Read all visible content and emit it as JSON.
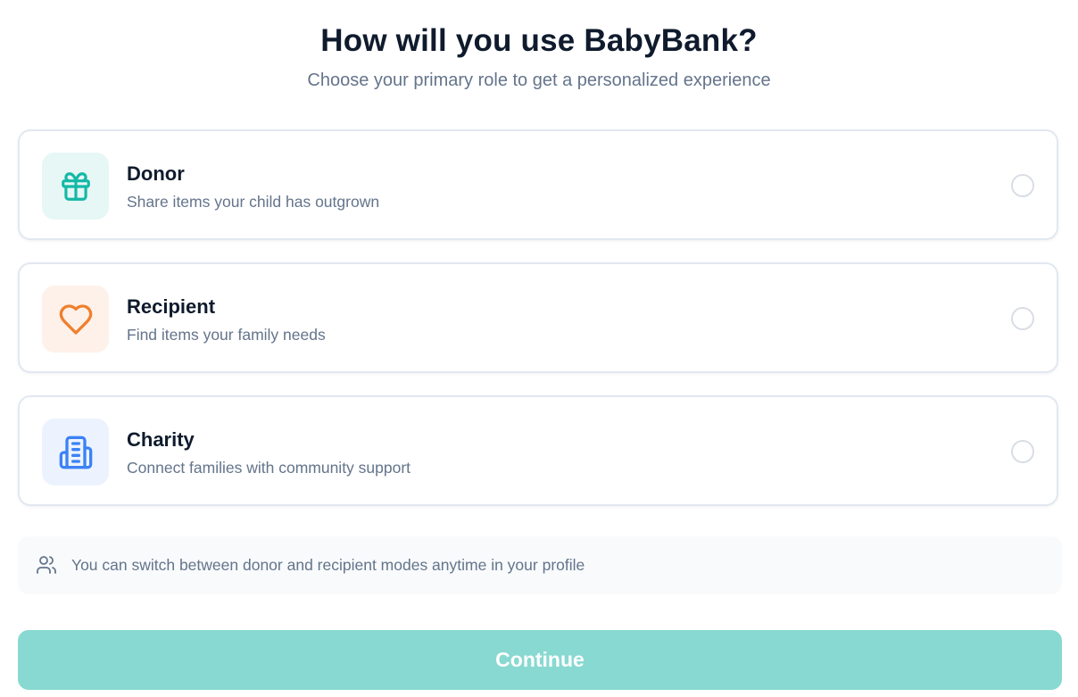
{
  "header": {
    "title": "How will you use BabyBank?",
    "subtitle": "Choose your primary role to get a personalized experience"
  },
  "roles": [
    {
      "title": "Donor",
      "description": "Share items your child has outgrown",
      "icon": "gift-icon",
      "icon_color": "#14b8a6",
      "tile_color": "#e6f7f5",
      "selected": false
    },
    {
      "title": "Recipient",
      "description": "Find items your family needs",
      "icon": "heart-icon",
      "icon_color": "#f07f2c",
      "tile_color": "#fef1ea",
      "selected": false
    },
    {
      "title": "Charity",
      "description": "Connect families with community support",
      "icon": "building-icon",
      "icon_color": "#3b82f6",
      "tile_color": "#edf3fe",
      "selected": false
    }
  ],
  "info": {
    "icon": "users-icon",
    "text": "You can switch between donor and recipient modes anytime in your profile"
  },
  "actions": {
    "continue_label": "Continue",
    "continue_enabled": false
  },
  "colors": {
    "accent": "#14b8a6",
    "button_disabled": "#88d9d1",
    "title": "#0f1b2d",
    "muted_text": "#64748b"
  }
}
